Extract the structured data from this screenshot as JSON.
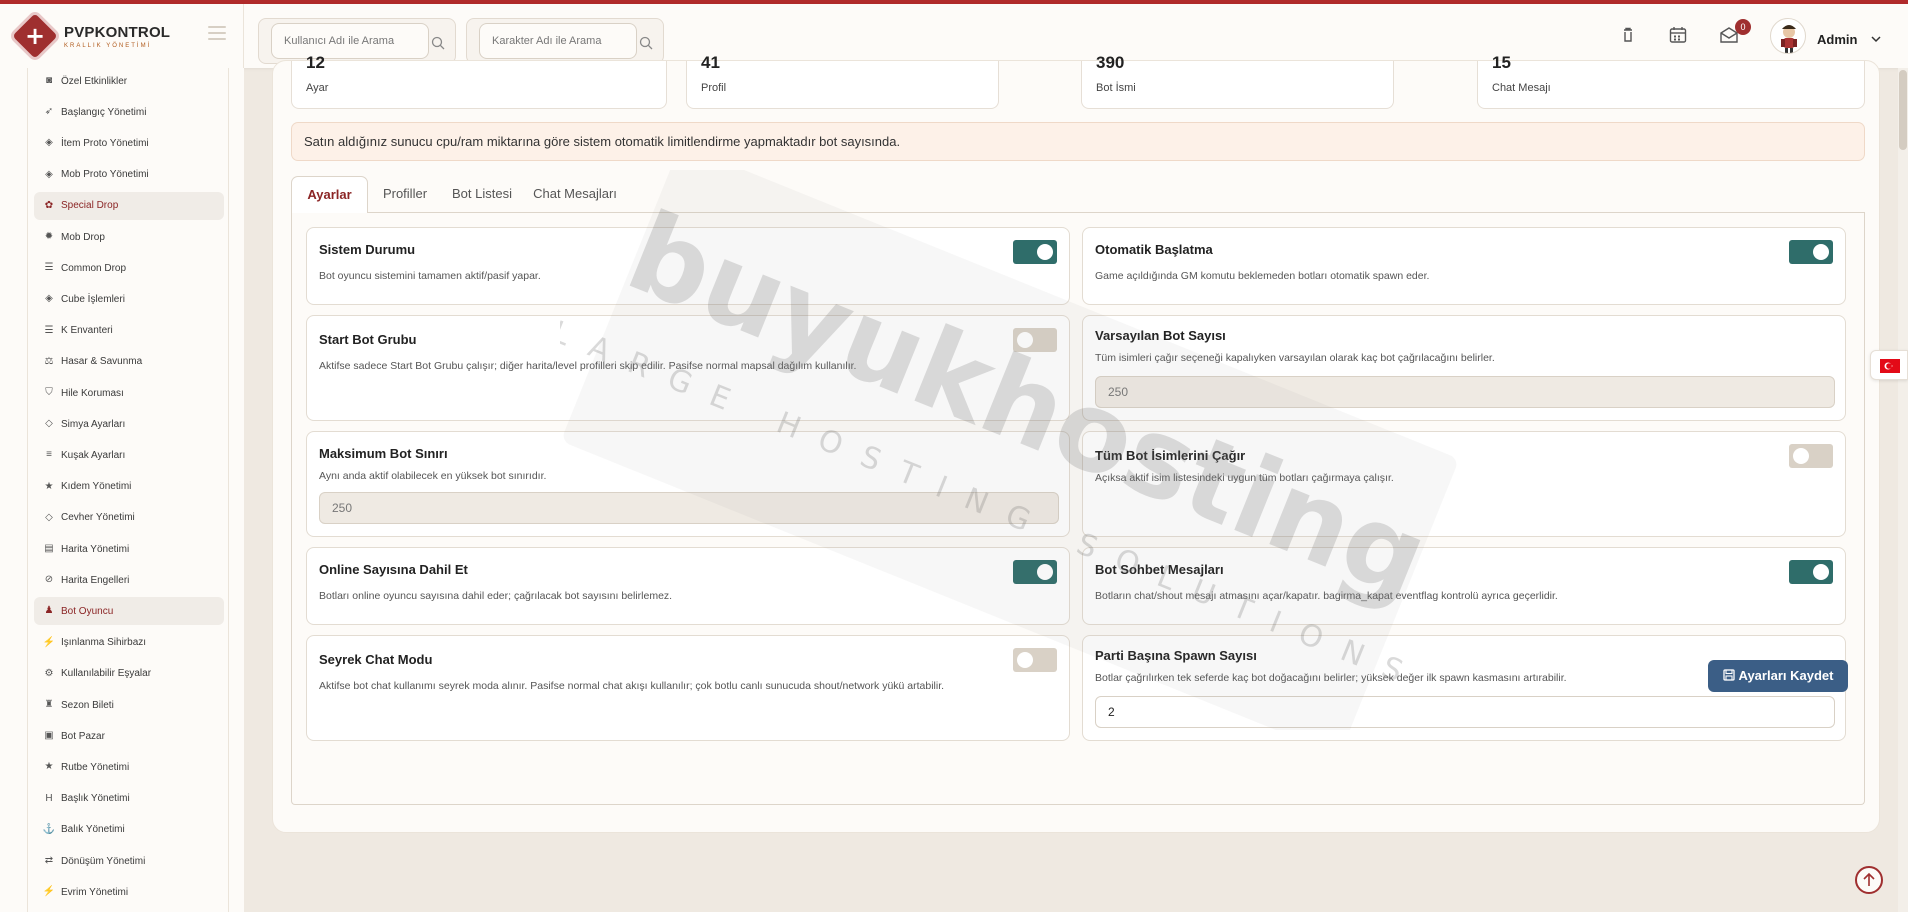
{
  "brand": {
    "name": "PVPKONTROL",
    "subtitle": "KRALLIK YÖNETİMİ"
  },
  "header": {
    "search_user": {
      "placeholder": "Kullanıcı Adı ile Arama"
    },
    "search_char": {
      "placeholder": "Karakter Adı ile Arama"
    },
    "notif_count": "0",
    "user": "Admin"
  },
  "sidebar": {
    "items": [
      {
        "label": "Özel Etkinlikler",
        "icon": "gamepad-icon"
      },
      {
        "label": "Başlangıç Yönetimi",
        "icon": "rocket-icon"
      },
      {
        "label": "İtem Proto Yönetimi",
        "icon": "cube-icon"
      },
      {
        "label": "Mob Proto Yönetimi",
        "icon": "cube-icon"
      },
      {
        "label": "Special Drop",
        "icon": "gift-icon"
      },
      {
        "label": "Mob Drop",
        "icon": "bug-icon"
      },
      {
        "label": "Common Drop",
        "icon": "list-icon"
      },
      {
        "label": "Cube İşlemleri",
        "icon": "cube-icon"
      },
      {
        "label": "K Envanteri",
        "icon": "list-icon"
      },
      {
        "label": "Hasar & Savunma",
        "icon": "scale-icon"
      },
      {
        "label": "Hile Koruması",
        "icon": "shield-icon"
      },
      {
        "label": "Simya Ayarları",
        "icon": "gem-icon"
      },
      {
        "label": "Kuşak Ayarları",
        "icon": "sliders-icon"
      },
      {
        "label": "Kıdem Yönetimi",
        "icon": "star-icon"
      },
      {
        "label": "Cevher Yönetimi",
        "icon": "gem-icon"
      },
      {
        "label": "Harita Yönetimi",
        "icon": "map-icon"
      },
      {
        "label": "Harita Engelleri",
        "icon": "ban-icon"
      },
      {
        "label": "Bot Oyuncu",
        "icon": "robot-icon"
      },
      {
        "label": "Işınlanma Sihirbazı",
        "icon": "wand-icon"
      },
      {
        "label": "Kullanılabilir Eşyalar",
        "icon": "gears-icon"
      },
      {
        "label": "Sezon Bileti",
        "icon": "trophy-icon"
      },
      {
        "label": "Bot Pazar",
        "icon": "shop-icon"
      },
      {
        "label": "Rutbe Yönetimi",
        "icon": "star-icon"
      },
      {
        "label": "Başlık Yönetimi",
        "icon": "heading-icon"
      },
      {
        "label": "Balık Yönetimi",
        "icon": "anchor-icon"
      },
      {
        "label": "Dönüşüm Yönetimi",
        "icon": "shuffle-icon"
      },
      {
        "label": "Evrim Yönetimi",
        "icon": "wand-icon"
      }
    ]
  },
  "stats": [
    {
      "value": "12",
      "label": "Ayar"
    },
    {
      "value": "41",
      "label": "Profil"
    },
    {
      "value": "390",
      "label": "Bot İsmi"
    },
    {
      "value": "15",
      "label": "Chat Mesajı"
    }
  ],
  "info_text": "Satın aldığınız sunucu cpu/ram miktarına göre sistem otomatik limitlendirme yapmaktadır bot sayısında.",
  "tabs": [
    "Ayarlar",
    "Profiller",
    "Bot Listesi",
    "Chat Mesajları"
  ],
  "settings": {
    "sistem_durumu": {
      "title": "Sistem Durumu",
      "desc": "Bot oyuncu sistemini tamamen aktif/pasif yapar.",
      "enabled": true
    },
    "otomatik_baslatma": {
      "title": "Otomatik Başlatma",
      "desc": "Game açıldığında GM komutu beklemeden botları otomatik spawn eder.",
      "enabled": true
    },
    "start_bot_grubu": {
      "title": "Start Bot Grubu",
      "desc": "Aktifse sadece Start Bot Grubu çalışır; diğer harita/level profilleri skip edilir. Pasifse normal mapsal dağılım kullanılır.",
      "enabled": false
    },
    "varsayilan_bot_sayisi": {
      "title": "Varsayılan Bot Sayısı",
      "desc": "Tüm isimleri çağır seçeneği kapalıyken varsayılan olarak kaç bot çağrılacağını belirler.",
      "value": "250"
    },
    "maksimum_bot_siniri": {
      "title": "Maksimum Bot Sınırı",
      "desc": "Aynı anda aktif olabilecek en yüksek bot sınırıdır.",
      "value": "250"
    },
    "tum_bot_isimleri": {
      "title": "Tüm Bot İsimlerini Çağır",
      "desc": "Açıksa aktif isim listesindeki uygun tüm botları çağırmaya çalışır.",
      "enabled": false
    },
    "online_sayisi": {
      "title": "Online Sayısına Dahil Et",
      "desc": "Botları online oyuncu sayısına dahil eder; çağrılacak bot sayısını belirlemez.",
      "enabled": true
    },
    "bot_sohbet": {
      "title": "Bot Sohbet Mesajları",
      "desc": "Botların chat/shout mesajı atmasını açar/kapatır. bagirma_kapat eventflag kontrolü ayrıca geçerlidir.",
      "enabled": true
    },
    "seyrek_chat": {
      "title": "Seyrek Chat Modu",
      "desc": "Aktifse bot chat kullanımı seyrek moda alınır. Pasifse normal chat akışı kullanılır; çok botlu canlı sunucuda shout/network yükü artabilir.",
      "enabled": false
    },
    "parti_spawn": {
      "title": "Parti Başına Spawn Sayısı",
      "desc": "Botlar çağrılırken tek seferde kaç bot doğacağını belirler; yüksek değer ilk spawn kasmasını artırabilir.",
      "value": "2"
    }
  },
  "save_label": "Ayarları Kaydet",
  "watermark": {
    "brand": "buyukhosting",
    "tagline": "LARGE HOSTING SOLUTIONS"
  },
  "colors": {
    "accent": "#9f2f2f",
    "toggle_on": "#2f6d6a",
    "save_button": "#3b5e86",
    "info_bg": "#fdf1e8"
  }
}
